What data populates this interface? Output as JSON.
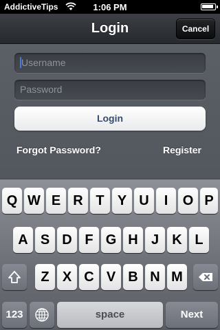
{
  "status_bar": {
    "carrier": "AddictiveTips",
    "time": "1:06 PM",
    "icons": [
      "wifi-icon",
      "battery-icon"
    ]
  },
  "nav": {
    "title": "Login",
    "cancel_label": "Cancel"
  },
  "form": {
    "username_placeholder": "Username",
    "password_placeholder": "Password",
    "login_label": "Login",
    "forgot_label": "Forgot Password?",
    "register_label": "Register"
  },
  "keyboard": {
    "row1": [
      "Q",
      "W",
      "E",
      "R",
      "T",
      "Y",
      "U",
      "I",
      "O",
      "P"
    ],
    "row2": [
      "A",
      "S",
      "D",
      "F",
      "G",
      "H",
      "J",
      "K",
      "L"
    ],
    "row3": [
      "Z",
      "X",
      "C",
      "V",
      "B",
      "N",
      "M"
    ],
    "numbers_label": "123",
    "space_label": "space",
    "next_label": "Next",
    "icons": [
      "shift-icon",
      "backspace-icon",
      "globe-icon"
    ]
  },
  "colors": {
    "accent_cursor": "#4a7bd8",
    "login_text": "#3a4a6b"
  }
}
